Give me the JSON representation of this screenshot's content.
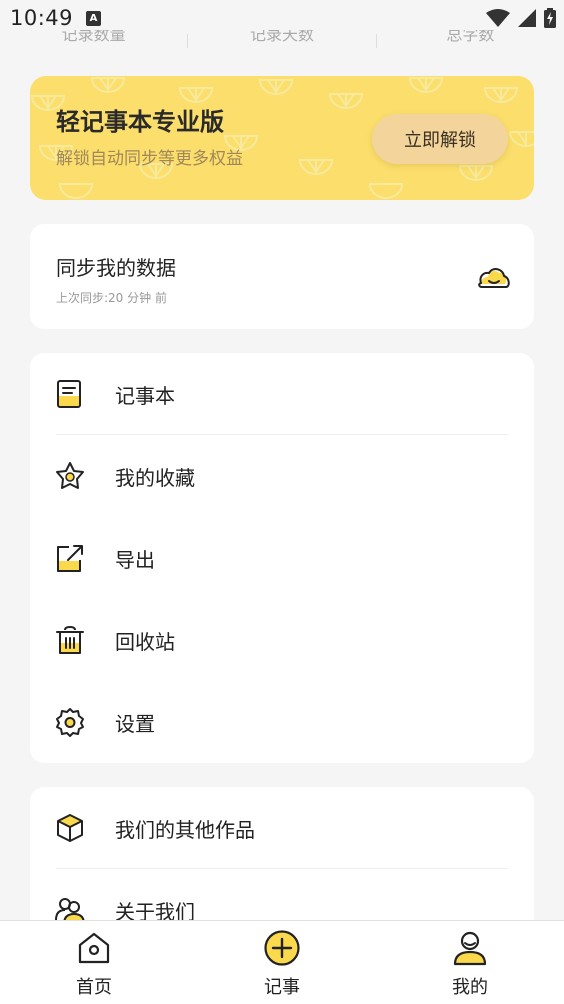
{
  "status_bar": {
    "time": "10:49",
    "notification_badge": "A"
  },
  "stats": {
    "labels": [
      "记录数量",
      "记录天数",
      "总字数"
    ]
  },
  "pro_banner": {
    "title": "轻记事本专业版",
    "subtitle": "解锁自动同步等更多权益",
    "button_label": "立即解锁",
    "background_color": "#fbde6b"
  },
  "sync": {
    "title": "同步我的数据",
    "last_sync": "上次同步:20 分钟 前",
    "icon": "cloud-icon"
  },
  "menu": {
    "items": [
      {
        "label": "记事本",
        "icon": "notebook-icon"
      },
      {
        "label": "我的收藏",
        "icon": "star-icon"
      },
      {
        "label": "导出",
        "icon": "export-icon"
      },
      {
        "label": "回收站",
        "icon": "trash-icon"
      },
      {
        "label": "设置",
        "icon": "gear-icon"
      }
    ]
  },
  "menu2": {
    "items": [
      {
        "label": "我们的其他作品",
        "icon": "box-icon"
      },
      {
        "label": "关于我们",
        "icon": "team-icon"
      }
    ]
  },
  "bottom_nav": {
    "items": [
      {
        "label": "首页",
        "icon": "home-icon"
      },
      {
        "label": "记事",
        "icon": "add-circle-icon"
      },
      {
        "label": "我的",
        "icon": "profile-icon"
      }
    ]
  },
  "colors": {
    "accent": "#fbd94d",
    "background": "#f5f5f5"
  }
}
